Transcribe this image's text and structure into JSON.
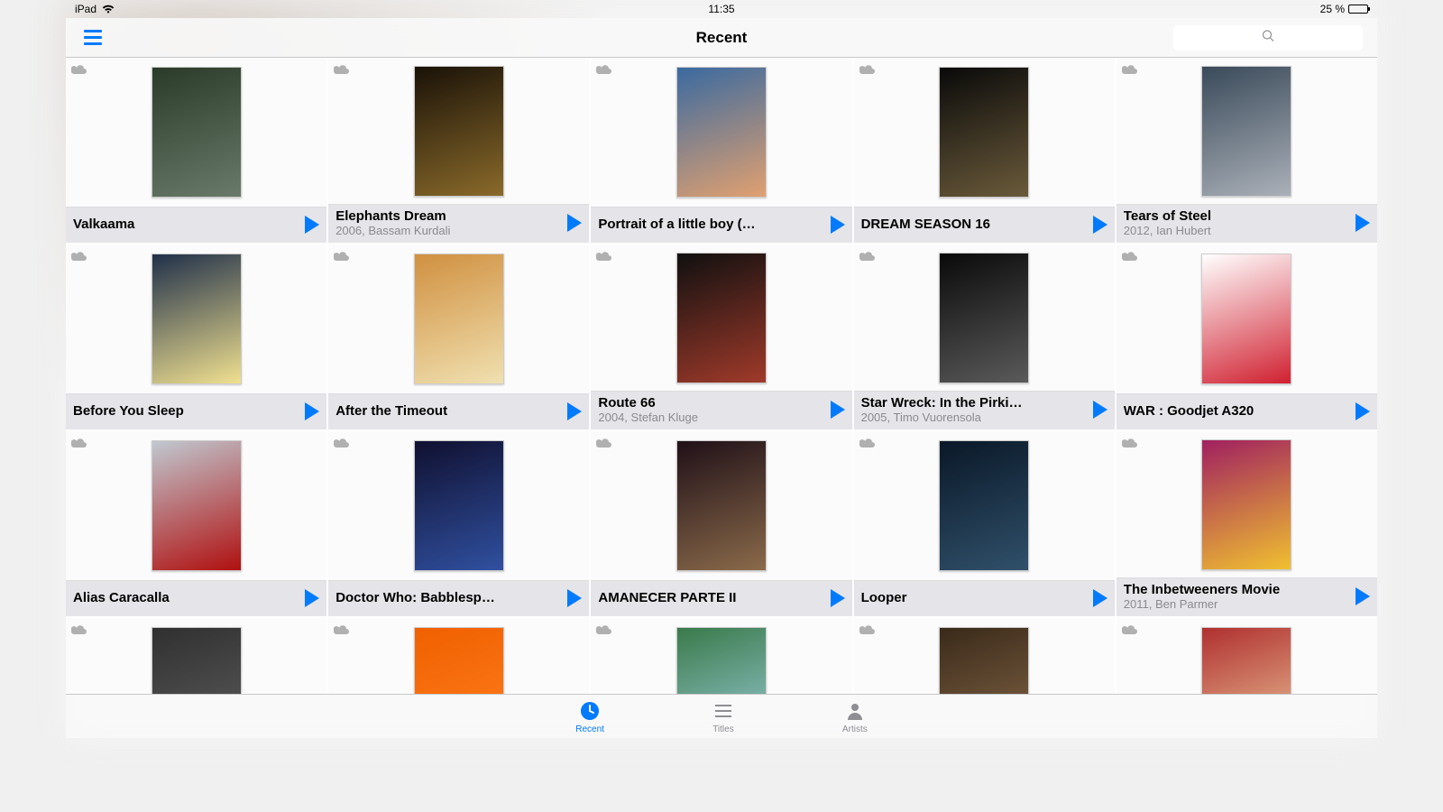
{
  "status": {
    "device": "iPad",
    "time": "11:35",
    "battery": "25 %"
  },
  "nav": {
    "title": "Recent",
    "search_placeholder": ""
  },
  "tabs": {
    "recent": "Recent",
    "titles": "Titles",
    "artists": "Artists"
  },
  "items": [
    {
      "title": "Valkaama",
      "sub": ""
    },
    {
      "title": "Elephants Dream",
      "sub": "2006, Bassam Kurdali"
    },
    {
      "title": "Portrait of a little boy (…",
      "sub": ""
    },
    {
      "title": "DREAM SEASON 16",
      "sub": ""
    },
    {
      "title": "Tears of Steel",
      "sub": "2012, Ian Hubert"
    },
    {
      "title": "Before You Sleep",
      "sub": ""
    },
    {
      "title": "After the Timeout",
      "sub": ""
    },
    {
      "title": "Route 66",
      "sub": "2004, Stefan Kluge"
    },
    {
      "title": "Star Wreck: In the Pirki…",
      "sub": "2005, Timo Vuorensola"
    },
    {
      "title": "WAR : Goodjet A320",
      "sub": ""
    },
    {
      "title": "Alias Caracalla",
      "sub": ""
    },
    {
      "title": "Doctor Who: Babblesp…",
      "sub": ""
    },
    {
      "title": "AMANECER PARTE II",
      "sub": ""
    },
    {
      "title": "Looper",
      "sub": ""
    },
    {
      "title": "The Inbetweeners Movie",
      "sub": "2011, Ben Parmer"
    },
    {
      "title": "",
      "sub": ""
    },
    {
      "title": "",
      "sub": ""
    },
    {
      "title": "",
      "sub": ""
    },
    {
      "title": "",
      "sub": ""
    },
    {
      "title": "",
      "sub": ""
    }
  ],
  "poster_colors": [
    [
      "#2a3b2a",
      "#6a7a6a"
    ],
    [
      "#1a1208",
      "#8a6a2a"
    ],
    [
      "#3a6aa0",
      "#e0a070"
    ],
    [
      "#0a0a0a",
      "#6a5a3a"
    ],
    [
      "#3a4a5a",
      "#aab0b8"
    ],
    [
      "#20304a",
      "#f0e090"
    ],
    [
      "#d09040",
      "#f0e0b0"
    ],
    [
      "#101010",
      "#a03a2a"
    ],
    [
      "#0a0a0a",
      "#5a5a5a"
    ],
    [
      "#ffffff",
      "#d02030"
    ],
    [
      "#c0c8d0",
      "#b01010"
    ],
    [
      "#101030",
      "#3050a0"
    ],
    [
      "#201018",
      "#8a6a4a"
    ],
    [
      "#0a1828",
      "#30506a"
    ],
    [
      "#a02060",
      "#f0c030"
    ],
    [
      "#303030",
      "#606060"
    ],
    [
      "#f06000",
      "#ff8020"
    ],
    [
      "#3a7a4a",
      "#a0d0e0"
    ],
    [
      "#3a2a1a",
      "#8a6a4a"
    ],
    [
      "#b03030",
      "#f0d0a0"
    ]
  ]
}
